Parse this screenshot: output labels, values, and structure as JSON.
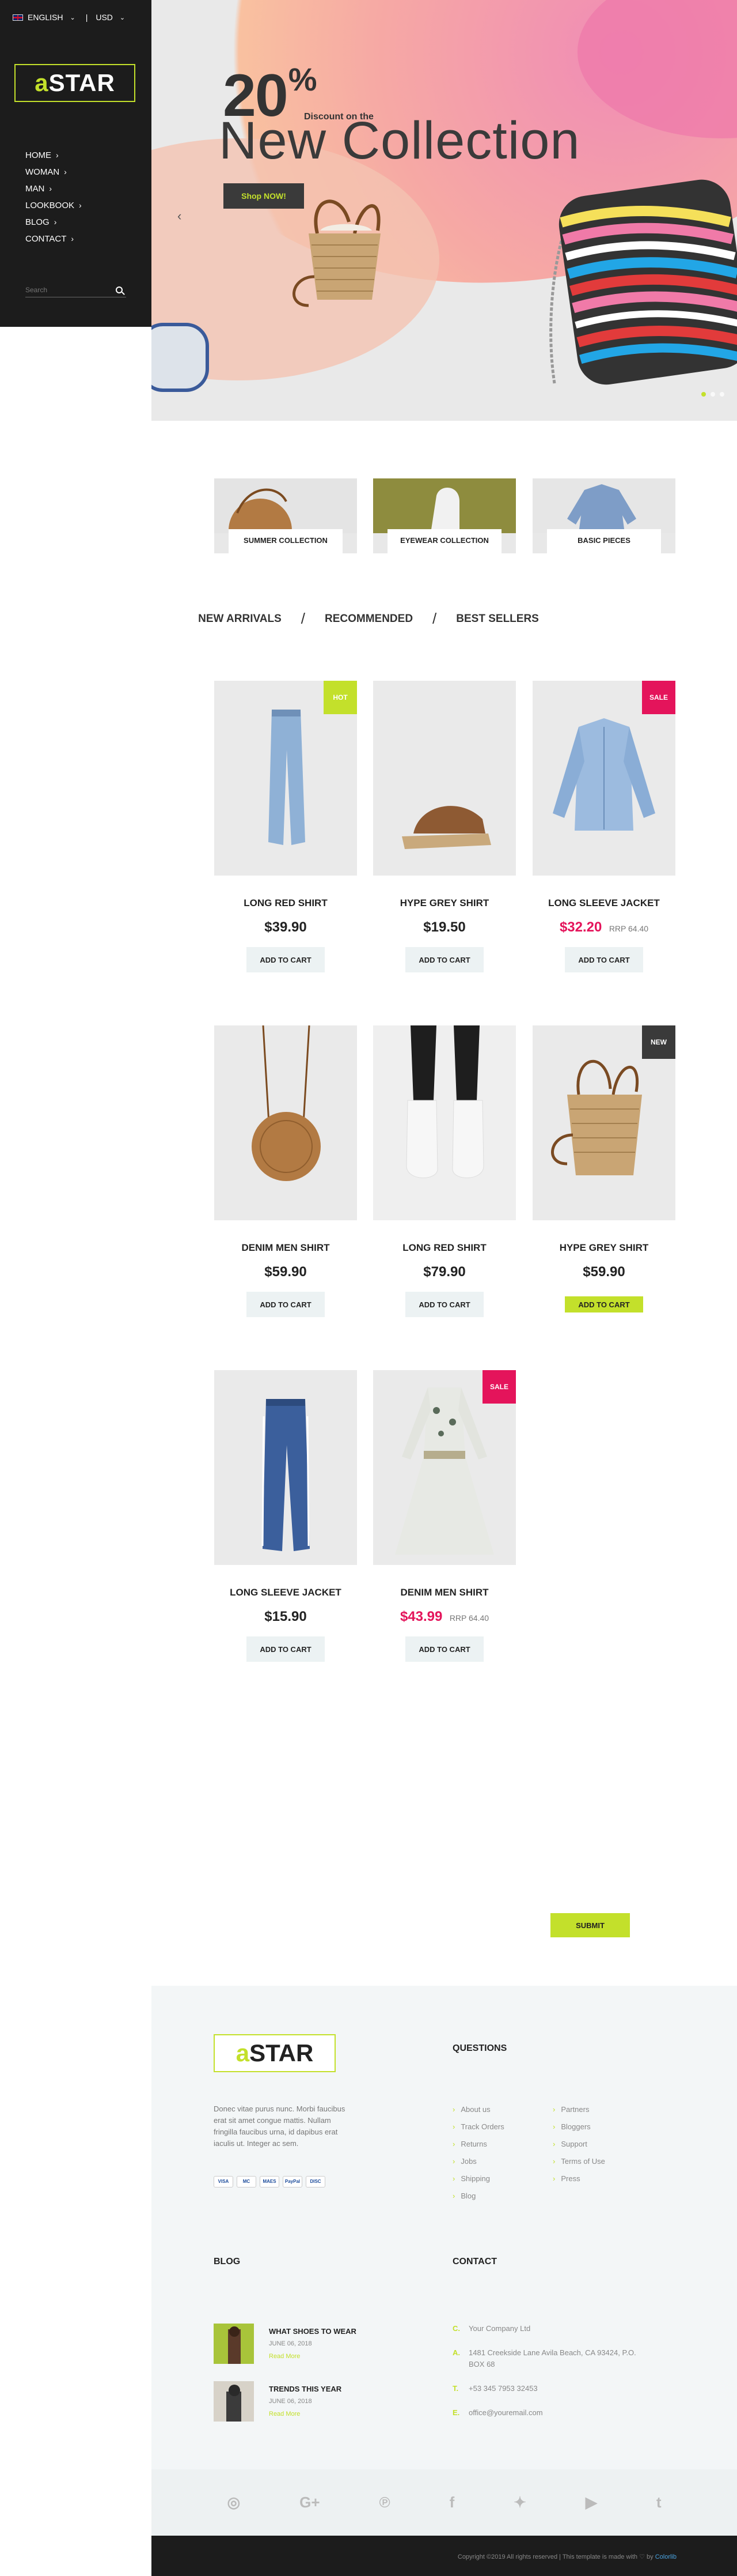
{
  "topbar": {
    "language": "ENGLISH",
    "currency": "USD"
  },
  "brand": {
    "logo_prefix": "a",
    "logo_suffix": "STAR"
  },
  "menu": [
    {
      "label": "HOME"
    },
    {
      "label": "WOMAN"
    },
    {
      "label": "MAN"
    },
    {
      "label": "LOOKBOOK"
    },
    {
      "label": "BLOG"
    },
    {
      "label": "CONTACT"
    }
  ],
  "search": {
    "placeholder": "Search"
  },
  "hero": {
    "percent": "20",
    "percent_sign": "%",
    "discount_text": "Discount on the",
    "headline": "New Collection",
    "button": "Shop NOW!",
    "prev_arrow": "‹"
  },
  "categories": [
    {
      "label": "SUMMER COLLECTION"
    },
    {
      "label": "EYEWEAR COLLECTION"
    },
    {
      "label": "BASIC PIECES"
    }
  ],
  "tabs": [
    "NEW ARRIVALS",
    "RECOMMENDED",
    "BEST SELLERS"
  ],
  "tab_separator": "/",
  "products": [
    {
      "name": "LONG RED SHIRT",
      "price": "$39.90",
      "rrp": "",
      "badge": "HOT",
      "button": "ADD TO CART"
    },
    {
      "name": "HYPE GREY SHIRT",
      "price": "$19.50",
      "rrp": "",
      "badge": "",
      "button": "ADD TO CART"
    },
    {
      "name": "LONG SLEEVE JACKET",
      "price": "$32.20",
      "rrp": "RRP 64.40",
      "badge": "SALE",
      "button": "ADD TO CART"
    },
    {
      "name": "DENIM MEN SHIRT",
      "price": "$59.90",
      "rrp": "",
      "badge": "",
      "button": "ADD TO CART"
    },
    {
      "name": "LONG RED SHIRT",
      "price": "$79.90",
      "rrp": "",
      "badge": "",
      "button": "ADD TO CART"
    },
    {
      "name": "HYPE GREY SHIRT",
      "price": "$59.90",
      "rrp": "",
      "badge": "NEW",
      "button": "ADD TO CART"
    },
    {
      "name": "LONG SLEEVE JACKET",
      "price": "$15.90",
      "rrp": "",
      "badge": "",
      "button": "ADD TO CART"
    },
    {
      "name": "DENIM MEN SHIRT",
      "price": "$43.99",
      "rrp": "RRP 64.40",
      "badge": "SALE",
      "button": "ADD TO CART"
    }
  ],
  "submit_button": "SUBMIT",
  "footer": {
    "description": "Donec vitae purus nunc. Morbi faucibus erat sit amet congue mattis. Nullam fringilla faucibus urna, id dapibus erat iaculis ut. Integer ac sem.",
    "payments": [
      "VISA",
      "MC",
      "MAES",
      "PayPal",
      "DISC"
    ],
    "questions_title": "QUESTIONS",
    "questions_col1": [
      "About us",
      "Track Orders",
      "Returns",
      "Jobs",
      "Shipping",
      "Blog"
    ],
    "questions_col2": [
      "Partners",
      "Bloggers",
      "Support",
      "Terms of Use",
      "Press"
    ],
    "blog_title": "BLOG",
    "posts": [
      {
        "title": "WHAT SHOES TO WEAR",
        "date": "JUNE 06, 2018",
        "more": "Read More"
      },
      {
        "title": "TRENDS THIS YEAR",
        "date": "JUNE 06, 2018",
        "more": "Read More"
      }
    ],
    "contact_title": "CONTACT",
    "contact": [
      {
        "key": "C.",
        "value": "Your Company Ltd"
      },
      {
        "key": "A.",
        "value": "1481 Creekside Lane Avila Beach, CA 93424, P.O. BOX 68"
      },
      {
        "key": "T.",
        "value": "+53 345 7953 32453"
      },
      {
        "key": "E.",
        "value": "office@youremail.com"
      }
    ],
    "social_icons": [
      "instagram-icon",
      "google-plus-icon",
      "pinterest-icon",
      "facebook-icon",
      "twitter-icon",
      "youtube-icon",
      "tumblr-icon"
    ],
    "copyright_prefix": "Copyright ©2019 All rights reserved | This template is made with ♡ by ",
    "copyright_link": "Colorlib"
  },
  "colors": {
    "accent": "#c3e02b",
    "sale": "#e4145b",
    "dark": "#1c1c1c"
  }
}
